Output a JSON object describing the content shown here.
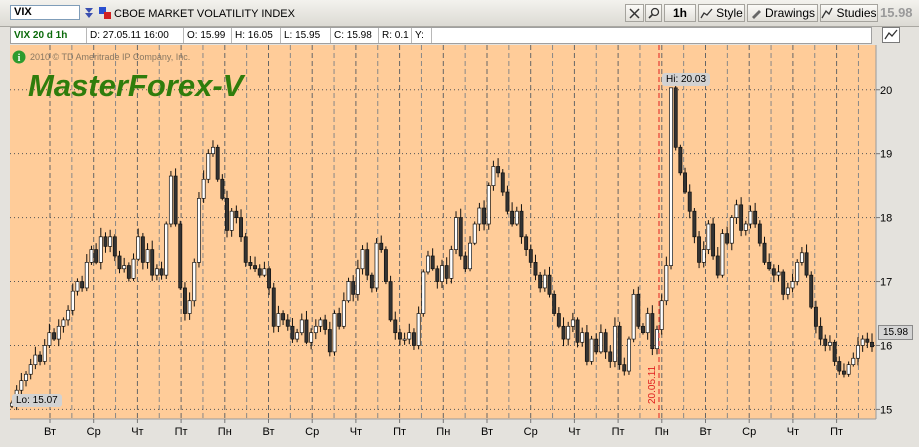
{
  "toolbar": {
    "symbol": "VIX",
    "description": "CBOE MARKET VOLATILITY INDEX",
    "timeframe_label": "1h",
    "style_label": "Style",
    "drawings_label": "Drawings",
    "studies_label": "Studies",
    "last_price": "15.98"
  },
  "infobar": {
    "study_label": "VIX 20 d 1h",
    "date": "D: 27.05.11 16:00",
    "open": "O: 15.99",
    "high": "H: 16.05",
    "low": "L: 15.95",
    "close": "C: 15.98",
    "range": "R: 0.1",
    "y": "Y:"
  },
  "watermark": {
    "copyright": "2010 © TD Ameritrade IP Company, Inc.",
    "title": "MasterForex-V"
  },
  "annotations": {
    "hi_label": "Hi: 20.03",
    "lo_label": "Lo: 15.07",
    "marker_date": "20.05.11",
    "current_price_tag": "15.98"
  },
  "colors": {
    "background": "#ffcc99",
    "candle_up": "#ffffff",
    "candle_down": "#333333",
    "wick": "#111111",
    "marker": "#e02020",
    "watermark": "#2f7d0c"
  },
  "chart_data": {
    "type": "candlestick",
    "x_tick_labels": [
      "Вт",
      "Ср",
      "Чт",
      "Пт",
      "Пн",
      "Вт",
      "Ср",
      "Чт",
      "Пт",
      "Пн",
      "Вт",
      "Ср",
      "Чт",
      "Пт",
      "Пн",
      "Вт",
      "Ср",
      "Чт",
      "Пт"
    ],
    "y_ticks": [
      15,
      16,
      17,
      18,
      19,
      20
    ],
    "ylim": [
      14.85,
      20.7
    ],
    "grid": true,
    "closes": [
      15.1,
      15.3,
      15.45,
      15.55,
      15.7,
      15.85,
      15.75,
      16.0,
      16.2,
      16.1,
      16.3,
      16.4,
      16.55,
      16.85,
      17.0,
      16.9,
      17.3,
      17.5,
      17.3,
      17.7,
      17.55,
      17.7,
      17.4,
      17.2,
      17.25,
      17.05,
      17.35,
      17.7,
      17.3,
      17.5,
      17.1,
      17.2,
      17.1,
      17.9,
      18.65,
      17.9,
      16.9,
      16.5,
      16.7,
      17.3,
      18.3,
      18.6,
      19.0,
      19.1,
      18.6,
      18.3,
      17.8,
      18.1,
      18.0,
      17.7,
      17.3,
      17.25,
      17.2,
      17.1,
      17.2,
      16.9,
      16.3,
      16.5,
      16.4,
      16.3,
      16.1,
      16.2,
      16.4,
      16.05,
      16.2,
      16.3,
      16.4,
      16.25,
      15.9,
      16.5,
      16.3,
      16.7,
      17.0,
      16.8,
      17.2,
      17.5,
      17.1,
      16.9,
      17.6,
      17.5,
      17.0,
      16.4,
      16.2,
      16.1,
      16.1,
      16.2,
      16.0,
      16.5,
      17.15,
      17.4,
      17.2,
      17.0,
      17.25,
      17.05,
      17.5,
      18.0,
      17.4,
      17.2,
      17.6,
      17.9,
      18.15,
      17.9,
      18.5,
      18.8,
      18.7,
      18.4,
      18.1,
      17.9,
      18.1,
      17.7,
      17.5,
      17.3,
      17.1,
      16.9,
      17.1,
      16.8,
      16.5,
      16.3,
      16.1,
      16.3,
      16.4,
      16.05,
      16.2,
      15.75,
      16.1,
      15.9,
      16.2,
      15.9,
      15.75,
      16.3,
      15.7,
      15.6,
      16.1,
      16.8,
      16.3,
      16.2,
      16.5,
      15.95,
      16.25,
      16.7,
      17.25,
      20.03,
      19.1,
      18.7,
      18.4,
      18.1,
      17.7,
      17.3,
      17.5,
      17.9,
      17.4,
      17.1,
      17.75,
      17.6,
      18.0,
      18.2,
      17.8,
      17.9,
      18.1,
      17.9,
      17.6,
      17.3,
      17.2,
      17.1,
      17.15,
      16.8,
      16.9,
      17.0,
      17.3,
      17.45,
      17.1,
      16.6,
      16.3,
      16.1,
      16.0,
      16.05,
      15.75,
      15.6,
      15.55,
      15.7,
      15.8,
      16.0,
      16.1,
      16.05,
      15.98
    ]
  }
}
